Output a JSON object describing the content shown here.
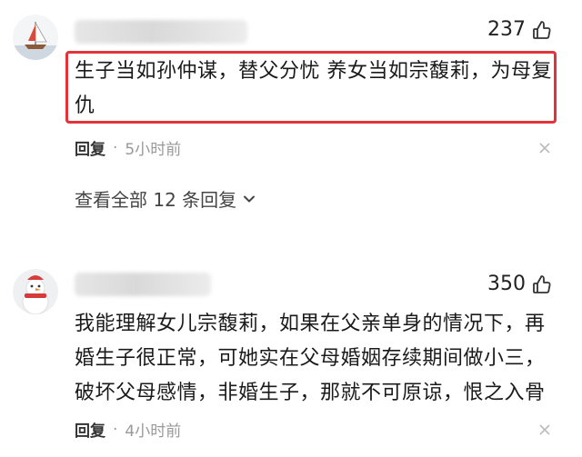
{
  "comments": [
    {
      "likes": "237",
      "text_line1": "生子当如孙仲谋，替父分忧 养女当如宗馥莉，为母复",
      "text_line2": "仇",
      "reply_label": "回复",
      "separator": "·",
      "time": "5小时前",
      "view_all_label": "查看全部 12 条回复"
    },
    {
      "likes": "350",
      "text_line1": "我能理解女儿宗馥莉，如果在父亲单身的情况下，再",
      "text_line2": "婚生子很正常，可她实在父母婚姻存续期间做小三，",
      "text_line3": "破坏父母感情，非婚生子，那就不可原谅，恨之入骨",
      "reply_label": "回复",
      "separator": "·",
      "time": "4小时前"
    }
  ],
  "icons": {
    "like": "thumbs-up-icon",
    "close": "close-icon",
    "chevron": "chevron-down-icon"
  },
  "colors": {
    "highlight_border": "#e2333b",
    "secondary_text": "#999999"
  }
}
